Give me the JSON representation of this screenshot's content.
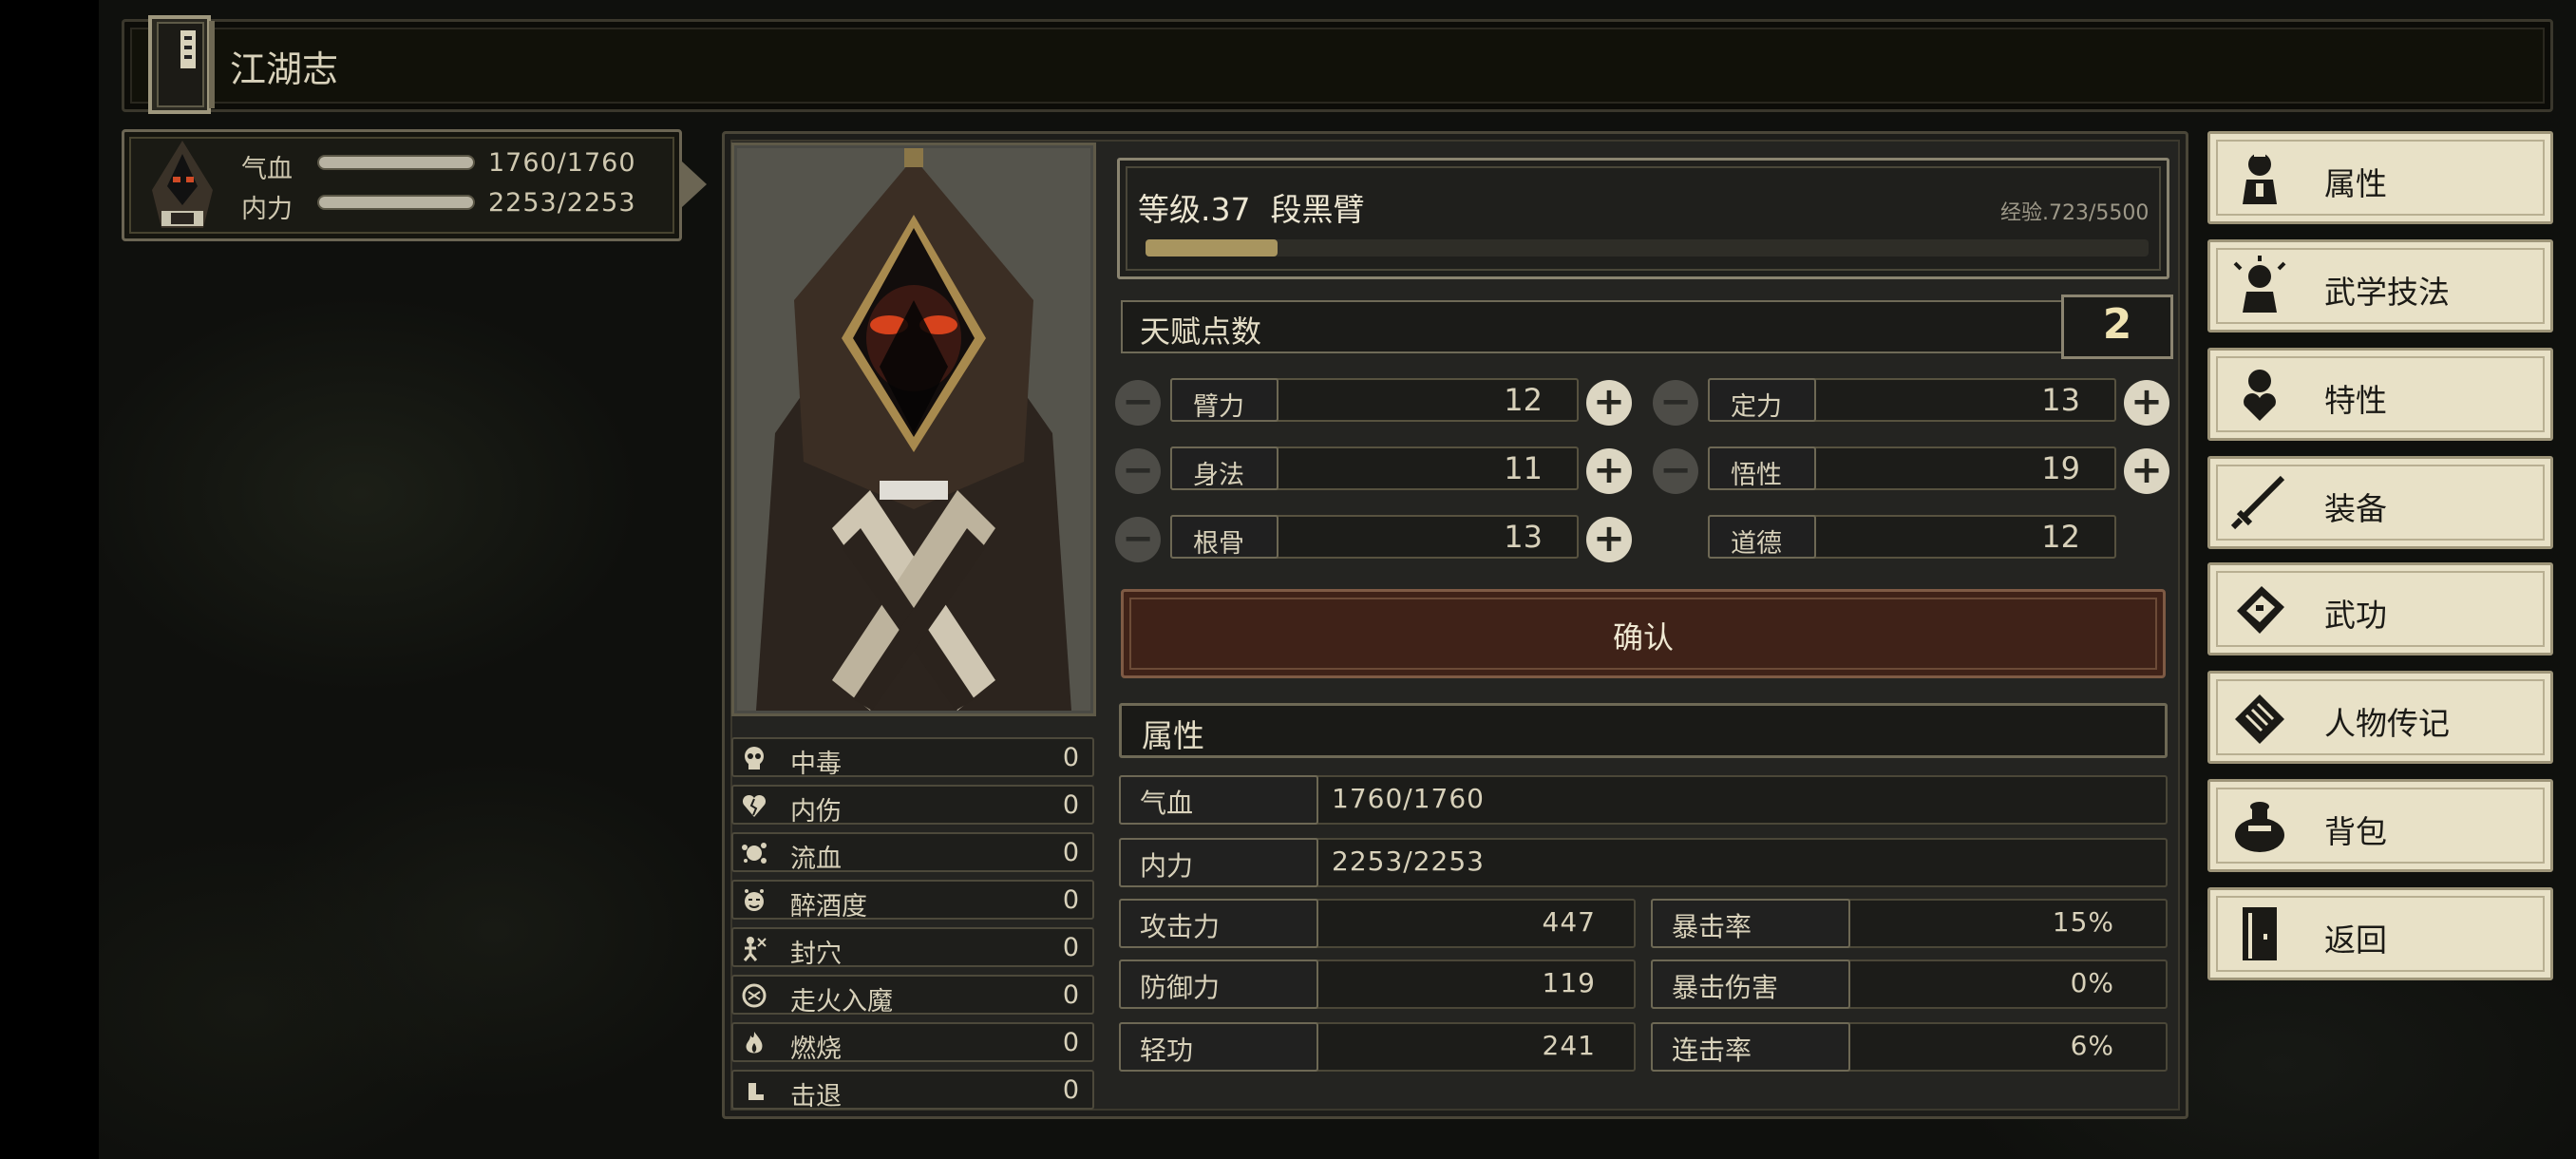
{
  "title": "江湖志",
  "player": {
    "hp_label": "气血",
    "hp_value": "1760/1760",
    "hp_fraction": 1.0,
    "mp_label": "内力",
    "mp_value": "2253/2253",
    "mp_fraction": 1.0
  },
  "level": {
    "text": "等级.37  段黑臂",
    "exp_text": "经验.723/5500",
    "exp_fraction": 0.1315
  },
  "talent": {
    "label": "天赋点数",
    "points": "2"
  },
  "attributes": [
    {
      "name": "臂力",
      "value": "12"
    },
    {
      "name": "定力",
      "value": "13"
    },
    {
      "name": "身法",
      "value": "11"
    },
    {
      "name": "悟性",
      "value": "19"
    },
    {
      "name": "根骨",
      "value": "13"
    },
    {
      "name": "道德",
      "value": "12"
    }
  ],
  "confirm_label": "确认",
  "status_effects": [
    {
      "label": "中毒",
      "value": "0",
      "icon": "skull-icon"
    },
    {
      "label": "内伤",
      "value": "0",
      "icon": "broken-heart-icon"
    },
    {
      "label": "流血",
      "value": "0",
      "icon": "blood-splat-icon"
    },
    {
      "label": "醉酒度",
      "value": "0",
      "icon": "drunk-face-icon"
    },
    {
      "label": "封穴",
      "value": "0",
      "icon": "acupoint-icon"
    },
    {
      "label": "走火入魔",
      "value": "0",
      "icon": "spiral-icon"
    },
    {
      "label": "燃烧",
      "value": "0",
      "icon": "flame-icon"
    },
    {
      "label": "击退",
      "value": "0",
      "icon": "boot-icon"
    }
  ],
  "stats": {
    "section_title": "属性",
    "hp_label": "气血",
    "hp_value": "1760/1760",
    "mp_label": "内力",
    "mp_value": "2253/2253",
    "attack_label": "攻击力",
    "attack_value": "447",
    "crit_rate_label": "暴击率",
    "crit_rate_value": "15%",
    "defense_label": "防御力",
    "defense_value": "119",
    "crit_dmg_label": "暴击伤害",
    "crit_dmg_value": "0%",
    "agility_label": "轻功",
    "agility_value": "241",
    "combo_label": "连击率",
    "combo_value": "6%"
  },
  "menu": [
    {
      "label": "属性",
      "icon": "character-icon"
    },
    {
      "label": "武学技法",
      "icon": "character-sparkle-icon"
    },
    {
      "label": "特性",
      "icon": "character-heart-icon"
    },
    {
      "label": "装备",
      "icon": "sword-icon"
    },
    {
      "label": "武功",
      "icon": "manual-book-icon"
    },
    {
      "label": "人物传记",
      "icon": "biography-book-icon"
    },
    {
      "label": "背包",
      "icon": "bag-icon"
    },
    {
      "label": "返回",
      "icon": "door-icon"
    }
  ],
  "colors": {
    "panel": "#242421",
    "confirm": "#3f2218",
    "menu_bg": "#e8e1c7",
    "exp_fill": "#a8955f"
  }
}
